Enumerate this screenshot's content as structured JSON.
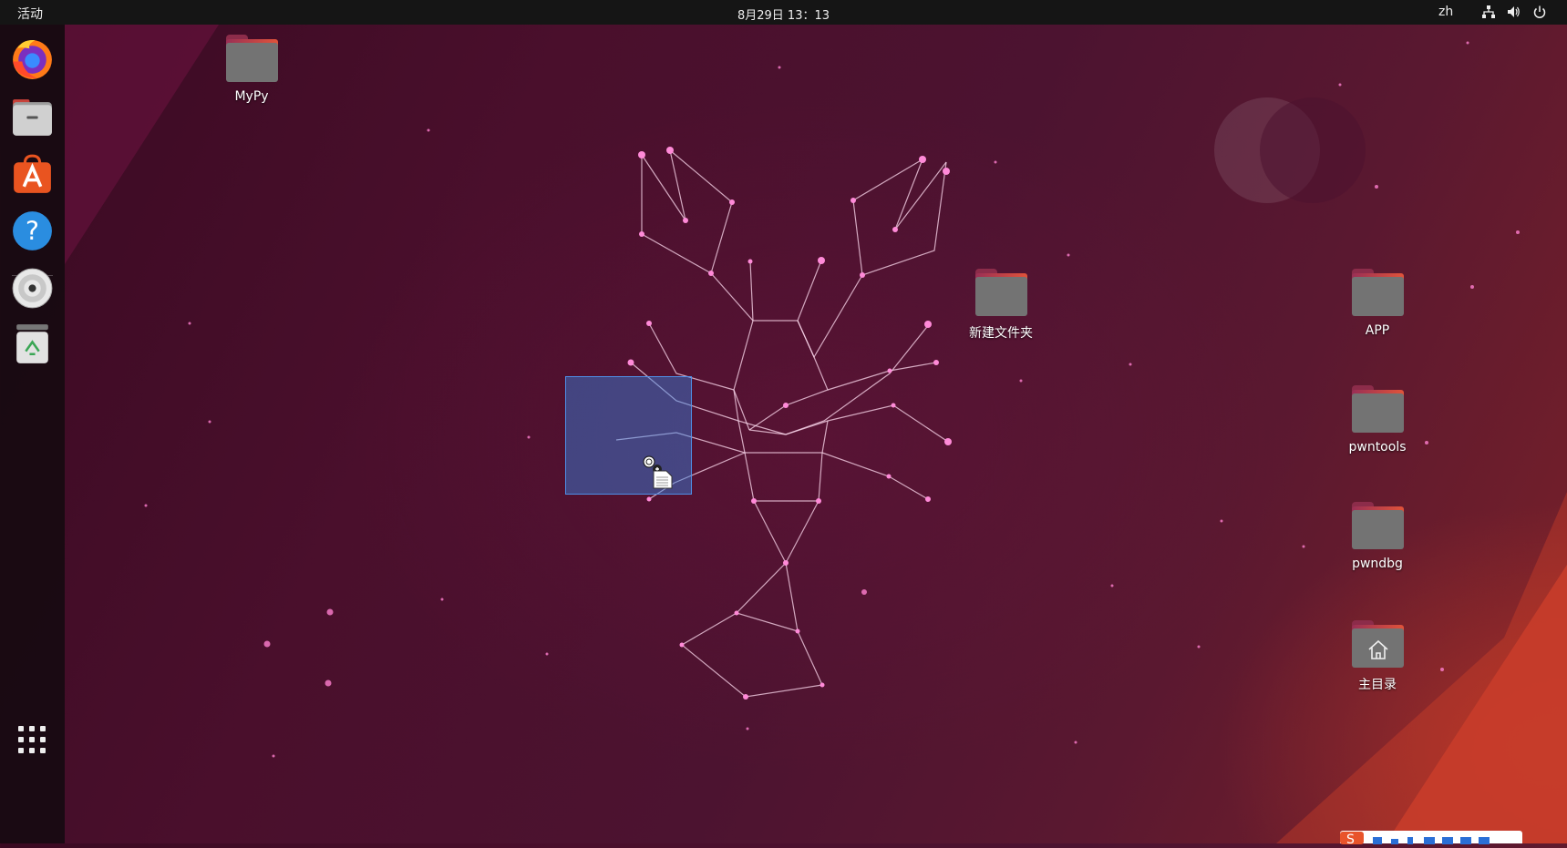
{
  "topbar": {
    "activities_label": "活动",
    "clock": "8月29日  13：13",
    "language": "zh"
  },
  "dock": {
    "items": [
      "firefox-icon",
      "files-icon",
      "software-center-icon",
      "help-icon",
      "disc-icon",
      "trash-icon"
    ],
    "app_grid_icon": "app-grid-icon"
  },
  "desktop": {
    "icons": {
      "mypy": "MyPy",
      "new_folder": "新建文件夹",
      "app": "APP",
      "pwntools": "pwntools",
      "pwndbg": "pwndbg",
      "home": "主目录"
    }
  },
  "colors": {
    "topbar": "#151515",
    "selection": "#3584e4",
    "wallpaper_accent": "#e0533a"
  }
}
